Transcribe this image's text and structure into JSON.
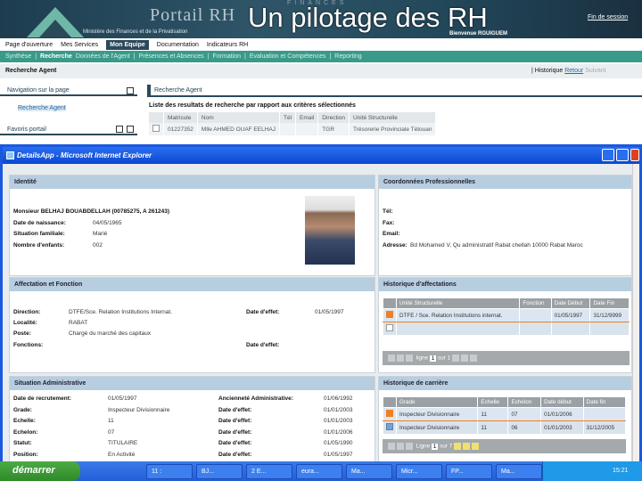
{
  "slide_title": "Un pilotage des RH",
  "portal": {
    "name": "Portail RH",
    "ministry": "Ministère des Finances et de la Privatisation",
    "watermark": "FINANCES",
    "logout": "Fin de session",
    "welcome": "Bienvenue RGUIGUEM"
  },
  "top_nav": [
    "Page d'ouverture",
    "Mes Services",
    "Mon Equipe",
    "Documentation",
    "Indicateurs RH"
  ],
  "sub_nav": [
    "Synthèse",
    "|",
    "Recherche",
    "Données de l'Agent",
    "|",
    "Présences et Absences",
    "|",
    "Formation",
    "|",
    "Evaluation et Compétences",
    "|",
    "Reporting"
  ],
  "page": {
    "title": "Recherche Agent",
    "history": "| Historique",
    "back": "Retour",
    "next": "Suivant"
  },
  "left": {
    "nav_title": "Navigation sur la page",
    "nav_item": "Recherche Agent",
    "favorites": "Favoris portail"
  },
  "search": {
    "header": "Recherche Agent",
    "list_title": "Liste des resultats de recherche par rapport aux critères sélectionnés",
    "columns": [
      "Matricule",
      "Nom",
      "Tél",
      "Email",
      "Direction",
      "Unité Structurelle"
    ],
    "rows": [
      [
        "01227352",
        "Mlle AHMED OUAF EELHAJ",
        "",
        "",
        "TGR",
        "Trésorerie Provinciale Tétouan"
      ]
    ]
  },
  "window": {
    "title": "DetailsApp - Microsoft Internet Explorer"
  },
  "identite": {
    "header": "Identité",
    "name": "Monsieur BELHAJ BOUABDELLAH (00785275, A 261243)",
    "fields": [
      {
        "label": "Date de naissance:",
        "value": "04/05/1965"
      },
      {
        "label": "Situation familiale:",
        "value": "Marié"
      },
      {
        "label": "Nombre d'enfants:",
        "value": "002"
      }
    ]
  },
  "coordonnees": {
    "header": "Coordonnées Professionnelles",
    "tel": "Tél:",
    "fax": "Fax:",
    "email": "Email:",
    "address_label": "Adresse:",
    "address": "Bd Mohamed V, Qu administratif Rabat chellah 10000 Rabat Maroc"
  },
  "affectation": {
    "header": "Affectation et Fonction",
    "direction_label": "Direction:",
    "direction": "DTFE/Sce. Relation Institutions Internat.",
    "date_effet_label": "Date d'effet:",
    "date_effet": "01/05/1997",
    "localite_label": "Localité:",
    "localite": "RABAT",
    "poste_label": "Poste:",
    "poste": "Chargé du marché des capitaux",
    "fonctions_label": "Fonctions:",
    "date_effet2_label": "Date d'effet:"
  },
  "hist_affect": {
    "header": "Historique d'affectations",
    "columns": [
      "Unité Structurelle",
      "Fonction",
      "Date Début",
      "Date Fin"
    ],
    "rows": [
      [
        "DTFE / Sce. Relation Institutions internat.",
        "",
        "01/05/1997",
        "31/12/9999"
      ]
    ],
    "pager": {
      "line": "ligne",
      "of": "sur 1",
      "current": "1"
    }
  },
  "situation": {
    "header": "Situation Administrative",
    "rows": [
      {
        "l1": "Date de recrutement:",
        "v1": "01/05/1997",
        "l2": "Ancienneté Administrative:",
        "v2": "01/06/1992"
      },
      {
        "l1": "Grade:",
        "v1": "Inspecteur Divisionnaire",
        "l2": "Date d'effet:",
        "v2": "01/01/2003"
      },
      {
        "l1": "Echelle:",
        "v1": "11",
        "l2": "Date d'effet:",
        "v2": "01/01/2003"
      },
      {
        "l1": "Echelon:",
        "v1": "07",
        "l2": "Date d'effet:",
        "v2": "01/01/2006"
      },
      {
        "l1": "Statut:",
        "v1": "TITULAIRE",
        "l2": "Date d'effet:",
        "v2": "01/05/1990"
      },
      {
        "l1": "Position:",
        "v1": "En Activité",
        "l2": "Date d'effet:",
        "v2": "01/05/1997"
      }
    ]
  },
  "hist_carriere": {
    "header": "Historique de carrière",
    "columns": [
      "Grade",
      "Echelle",
      "Echelon",
      "Date début",
      "Date fin"
    ],
    "rows": [
      [
        "Inspecteur Divisionnaire",
        "11",
        "07",
        "01/01/2006",
        ""
      ],
      [
        "Inspecteur Divisionnaire",
        "11",
        "06",
        "01/01/2003",
        "31/12/2005"
      ]
    ],
    "pager": {
      "line": "Ligne",
      "of": "sur 7",
      "current": "1"
    }
  },
  "taskbar": {
    "start": "démarrer",
    "tasks": [
      "11 :",
      "BJ...",
      "2 E...",
      "eura...",
      "Ma...",
      "Micr...",
      "FP...",
      "Ma..."
    ],
    "lang": "FR",
    "clock": "15:21"
  },
  "colors": {
    "banner": "#2f5568",
    "subnav": "#3a9a8a",
    "panel_header": "#b7cde0",
    "selected_marker": "#f08020",
    "xp_blue": "#245ed8"
  }
}
